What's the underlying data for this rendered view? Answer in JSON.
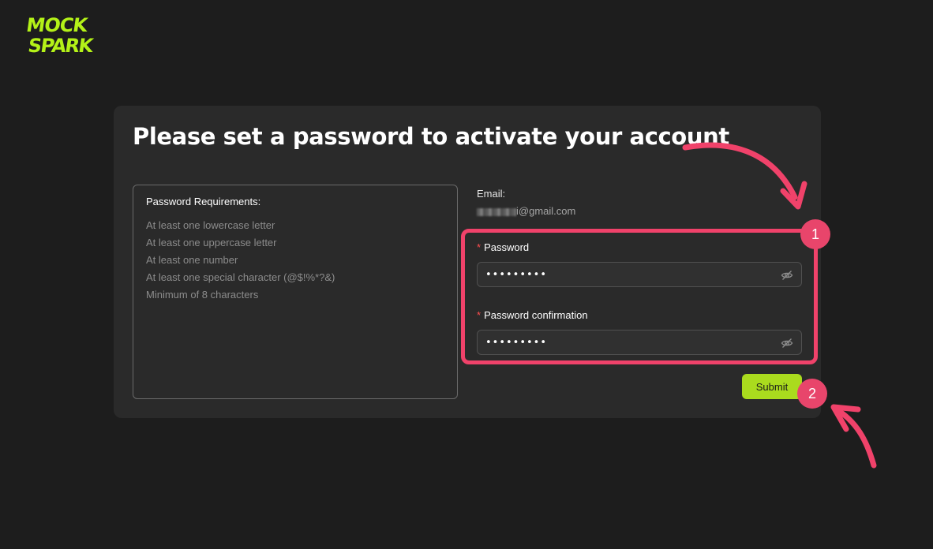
{
  "logo": {
    "line1": "MOCK",
    "line2": "SPARK",
    "color": "#b4f218"
  },
  "card": {
    "title": "Please set a password to activate your account"
  },
  "requirements": {
    "title": "Password Requirements:",
    "items": [
      "At least one lowercase letter",
      "At least one uppercase letter",
      "At least one number",
      "At least one special character (@$!%*?&)",
      "Minimum of 8 characters"
    ]
  },
  "form": {
    "email_label": "Email:",
    "email_value": "i@gmail.com",
    "password_label": "Password",
    "password_value": "•••••••••",
    "confirmation_label": "Password confirmation",
    "confirmation_value": "•••••••••",
    "required_marker": "*",
    "submit_label": "Submit"
  },
  "annotations": {
    "badge_1": "1",
    "badge_2": "2",
    "color": "#f0426a"
  },
  "icons": {
    "visibility_toggle": "eye-invisible-icon"
  }
}
